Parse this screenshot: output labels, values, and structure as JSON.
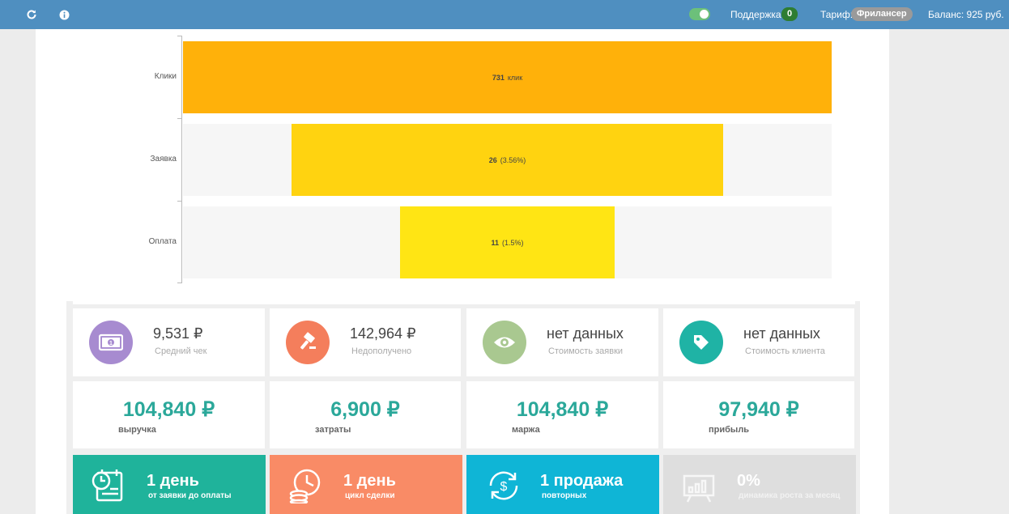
{
  "topbar": {
    "support_label": "Поддержка",
    "support_count": "0",
    "tariff_label": "Тариф:",
    "tariff_value": "Фрилансер",
    "balance": "Баланс: 925 руб."
  },
  "funnel": {
    "stages": [
      {
        "label": "Клики",
        "value_bold": "731",
        "value_rest": "клик",
        "percent": 100,
        "color": "#ffb10a"
      },
      {
        "label": "Заявка",
        "value_bold": "26",
        "value_rest": "(3.56%)",
        "percent": 66.5,
        "color": "#ffd310"
      },
      {
        "label": "Оплата",
        "value_bold": "11",
        "value_rest": "(1.5%)",
        "percent": 33,
        "color": "#ffe514"
      }
    ]
  },
  "stats": [
    {
      "value": "9,531 ₽",
      "label": "Средний чек",
      "icon": "money-icon",
      "color": "#a78bd0"
    },
    {
      "value": "142,964 ₽",
      "label": "Недополучено",
      "icon": "gavel-icon",
      "color": "#f47e5c"
    },
    {
      "value": "нет данных",
      "label": "Стоимость заявки",
      "icon": "eye-icon",
      "color": "#a9c890"
    },
    {
      "value": "нет данных",
      "label": "Стоимость клиента",
      "icon": "tag-icon",
      "color": "#1fb3a5"
    }
  ],
  "financials": [
    {
      "value": "104,840 ₽",
      "label": "выручка"
    },
    {
      "value": "6,900 ₽",
      "label": "затраты"
    },
    {
      "value": "104,840 ₽",
      "label": "маржа"
    },
    {
      "value": "97,940 ₽",
      "label": "прибыль"
    }
  ],
  "kpis": [
    {
      "value": "1 день",
      "label": "от заявки до оплаты",
      "icon": "calendar-clock-icon",
      "color": "#1fb39b"
    },
    {
      "value": "1 день",
      "label": "цикл сделки",
      "icon": "clock-coins-icon",
      "color": "#f98b66"
    },
    {
      "value": "1 продажа",
      "label": "повторных",
      "icon": "repeat-dollar-icon",
      "color": "#0fb5d6"
    },
    {
      "value": "0%",
      "label": "динамика роста за месяц",
      "icon": "growth-chart-icon",
      "color": "#dedede"
    }
  ]
}
